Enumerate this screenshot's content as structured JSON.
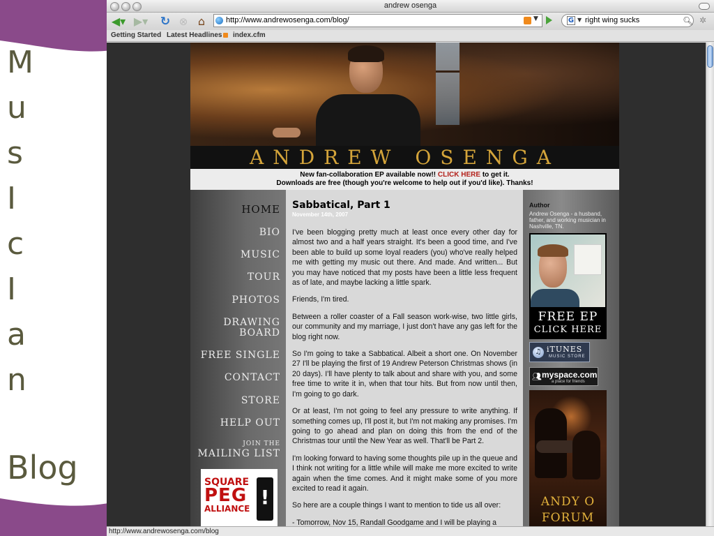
{
  "slide": {
    "letters": [
      "M",
      "u",
      "s",
      "I",
      "c",
      "I",
      "a",
      "n"
    ],
    "blog": "Blog",
    "accent_color": "#8a4a8a"
  },
  "browser": {
    "window_title": "andrew osenga",
    "url": "http://www.andrewosenga.com/blog/",
    "search_query": "right wing sucks",
    "search_engine_letter": "G",
    "bookmarks": [
      "Getting Started",
      "Latest Headlines",
      "index.cfm"
    ],
    "status_text": "http://www.andrewosenga.com/blog"
  },
  "site": {
    "name": "ANDREW OSENGA",
    "announcement": {
      "line1_before": "New fan-collaboration EP available now!! ",
      "line1_link": "CLICK HERE",
      "line1_after": " to get it.",
      "line2": "Downloads are free (though you're welcome to help out if you'd like). Thanks!"
    },
    "nav": {
      "home": "HOME",
      "bio": "BIO",
      "music": "MUSIC",
      "tour": "TOUR",
      "photos": "PHOTOS",
      "drawing_1": "DRAWING",
      "drawing_2": "BOARD",
      "free_single": "FREE SINGLE",
      "contact": "CONTACT",
      "store": "STORE",
      "help_out": "HELP OUT",
      "join_the": "JOIN THE",
      "mailing_list": "MAILING LIST"
    },
    "square_peg": {
      "square": "SQUARE",
      "peg": "PEG",
      "alliance": "ALLIANCE"
    },
    "post": {
      "title": "Sabbatical, Part 1",
      "date": "November 14th, 2007",
      "paragraphs": [
        "I've been blogging pretty much at least once every other day for almost two and a half years straight. It's been a good time, and I've been able to build up some loyal readers (you) who've really helped me with getting my music out there. And made. And written... But you may have noticed that my posts have been a little less frequent as of late, and maybe lacking a little spark.",
        "Friends, I'm tired.",
        "Between a roller coaster of a Fall season work-wise, two little girls, our community and my marriage, I just don't have any gas left for the blog right now.",
        "So I'm going to take a Sabbatical. Albeit a short one. On November 27 I'll be playing the first of 19 Andrew Peterson Christmas shows (in 20 days). I'll have plenty to talk about and share with you, and some free time to write it in, when that tour hits. But from now until then, I'm going to go dark.",
        "Or at least, I'm not going to feel any pressure to write anything. If something comes up, I'll post it, but I'm not making any promises. I'm going to go ahead and plan on doing this from the end of the Christmas tour until the New Year as well. That'll be Part 2.",
        "I'm looking forward to having some thoughts pile up in the queue and I think not writing for a little while will make me more excited to write again when the time comes. And it might make some of you more excited to read it again.",
        "So here are a couple things I want to mention to tide us all over:",
        "- Tomorrow, Nov 15, Randall Goodgame and I will be playing a"
      ]
    },
    "sidebar": {
      "author_label": "Author",
      "author_text": "Andrew Osenga - a husband, father, and working musician in Nashville, TN.",
      "ep_line1": "FREE EP",
      "ep_line2": "CLICK HERE",
      "itunes": "iTUNES",
      "itunes_sub": "MUSIC STORE",
      "myspace": "myspace.com",
      "myspace_sub": "a place for friends",
      "forum_line1": "ANDY O",
      "forum_line2": "FORUM"
    }
  }
}
